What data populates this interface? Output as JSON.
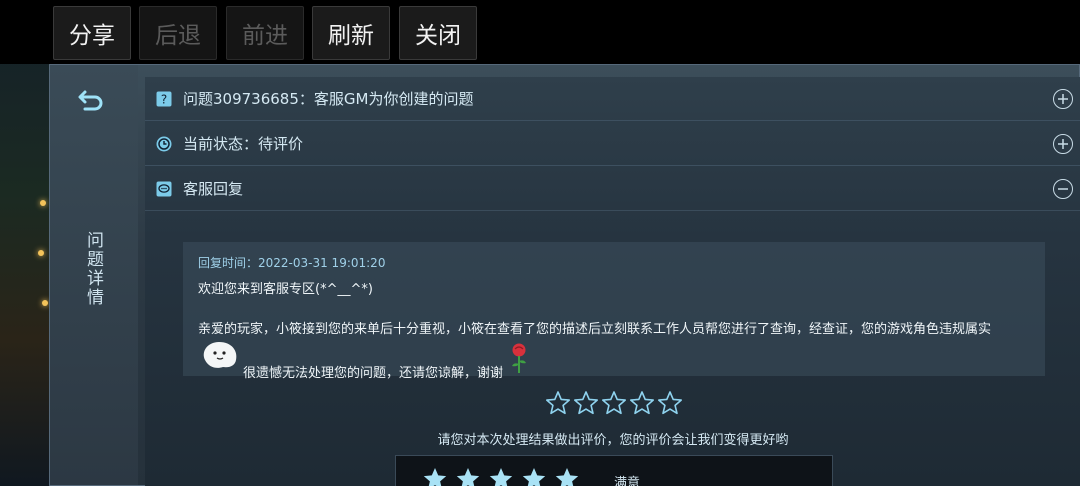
{
  "toolbar": {
    "share_label": "分享",
    "back_label": "后退",
    "forward_label": "前进",
    "refresh_label": "刷新",
    "close_label": "关闭"
  },
  "side": {
    "title": "问题详情",
    "back_icon": "return-arrow-icon"
  },
  "sections": [
    {
      "icon": "question-icon",
      "label": "问题309736685：客服GM为你创建的问题",
      "state": "collapsed"
    },
    {
      "icon": "clock-icon",
      "label": "当前状态：待评价",
      "state": "collapsed"
    },
    {
      "icon": "chat-bubble-icon",
      "label": "客服回复",
      "state": "expanded"
    }
  ],
  "reply": {
    "time": "回复时间：2022-03-31 19:01:20",
    "greeting": "欢迎您来到客服专区(*^__^*)",
    "body_line1": "亲爱的玩家，小筱接到您的来单后十分重视，小筱在查看了您的描述后立刻联系工作人员帮您进行了查询，经查证，您的游戏角色违规属实",
    "body_line2": "很遗憾无法处理您的问题，还请您谅解，谢谢"
  },
  "rating": {
    "prompt": "请您对本次处理结果做出评价，您的评价会让我们变得更好哟",
    "selected_label": "满意",
    "selected_stars": 5,
    "max_stars": 5
  },
  "colors": {
    "accent": "#9fd0e8",
    "star_outline": "#8fd3ef",
    "star_filled": "#a9e2f5"
  }
}
